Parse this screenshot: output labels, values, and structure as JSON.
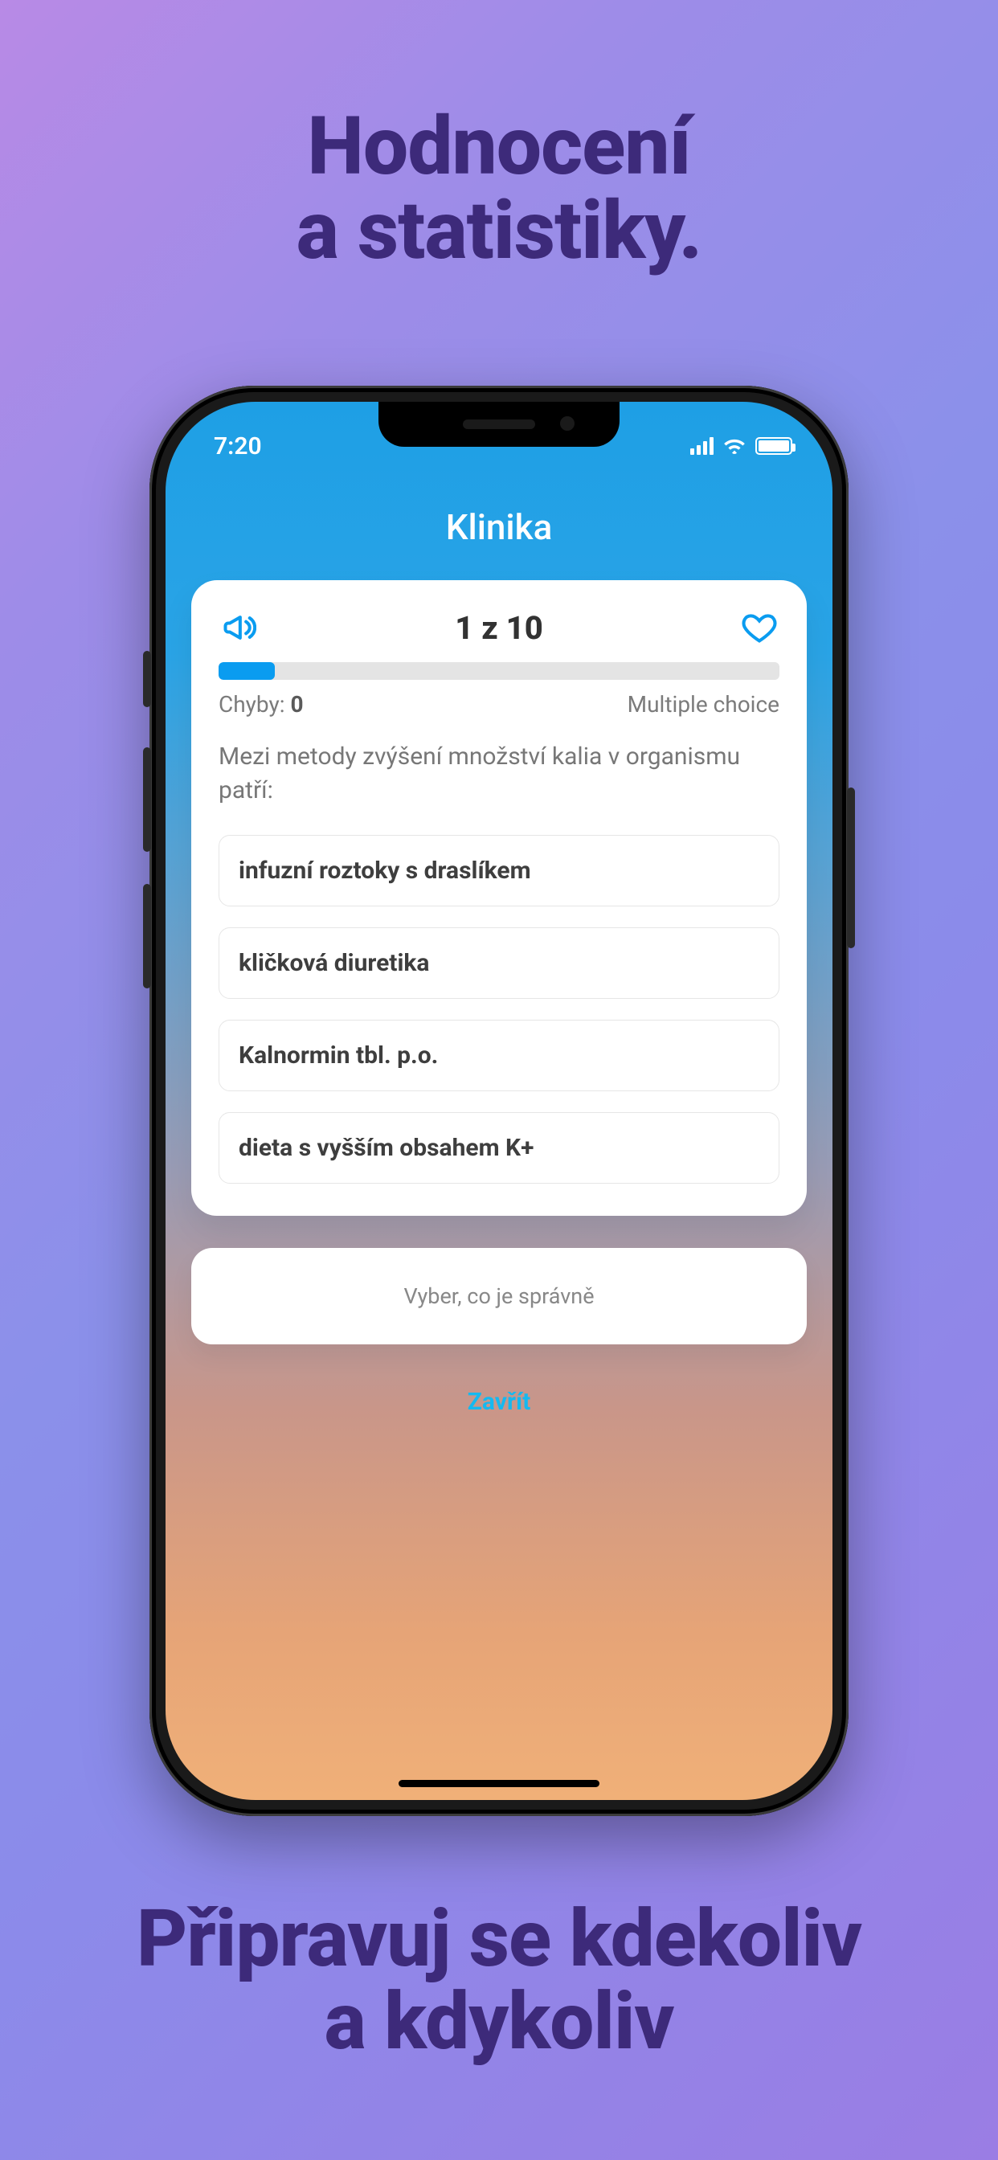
{
  "marketing": {
    "top_line1": "Hodnocení",
    "top_line2": "a statistiky.",
    "bottom_line1": "Připravuj se kdekoliv",
    "bottom_line2": "a kdykoliv"
  },
  "status": {
    "time": "7:20"
  },
  "screen": {
    "title": "Klinika",
    "counter": "1 z 10",
    "progress_percent": 10,
    "errors_label": "Chyby:",
    "errors_count": "0",
    "mode": "Multiple choice",
    "question": "Mezi metody zvýšení množství kalia v organismu patří:",
    "options": [
      "infuzní roztoky s draslíkem",
      "kličková diuretika",
      "Kalnormin tbl. p.o.",
      "dieta s vyšším obsahem K+"
    ],
    "prompt": "Vyber, co je správně",
    "close": "Zavřít"
  }
}
